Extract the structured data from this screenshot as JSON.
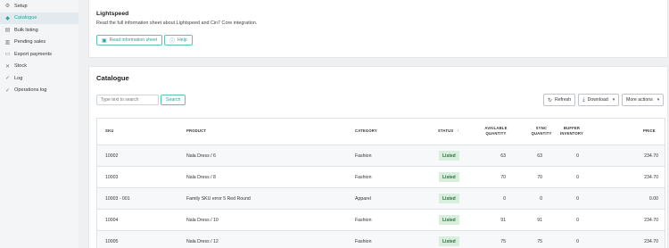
{
  "sidebar": {
    "items": [
      {
        "label": "Setup",
        "icon": "gear-icon",
        "active": false
      },
      {
        "label": "Catalogue",
        "icon": "tag-icon",
        "active": true
      },
      {
        "label": "Bulk listing",
        "icon": "list-icon",
        "active": false
      },
      {
        "label": "Pending sales",
        "icon": "receipt-icon",
        "active": false
      },
      {
        "label": "Export payments",
        "icon": "payment-icon",
        "active": false
      },
      {
        "label": "Stock",
        "icon": "tools-icon",
        "active": false
      },
      {
        "label": "Log",
        "icon": "check-icon",
        "active": false
      },
      {
        "label": "Operations log",
        "icon": "check-icon",
        "active": false
      }
    ]
  },
  "lightspeed": {
    "title": "Lightspeed",
    "description": "Read the full information sheet about Lightspeed and Cin7 Core integration.",
    "info_button": "Read information sheet",
    "help_button": "Help"
  },
  "catalogue": {
    "title": "Catalogue",
    "search_placeholder": "Type text to search",
    "search_button": "Search",
    "refresh_button": "Refresh",
    "download_button": "Download",
    "more_button": "More actions",
    "columns": {
      "sku": "SKU",
      "product": "PRODUCT",
      "category": "CATEGORY",
      "status": "STATUS",
      "available_1": "AVAILABLE",
      "available_2": "QUANTITY",
      "sync_1": "SYNC",
      "sync_2": "QUANTITY",
      "buffer_1": "BUFFER",
      "buffer_2": "INVENTORY",
      "price": "PRICE"
    },
    "rows": [
      {
        "sku": "10002",
        "product": "Nala Dress / 6",
        "category": "Fashion",
        "status": "Listed",
        "available": "63",
        "sync": "63",
        "buffer": "0",
        "price": "234.70"
      },
      {
        "sku": "10003",
        "product": "Nala Dress / 8",
        "category": "Fashion",
        "status": "Listed",
        "available": "70",
        "sync": "70",
        "buffer": "0",
        "price": "234.70"
      },
      {
        "sku": "10003 - 001",
        "product": "Family SKU error 5 Red Round",
        "category": "Apparel",
        "status": "Listed",
        "available": "0",
        "sync": "0",
        "buffer": "0",
        "price": "0.00"
      },
      {
        "sku": "10004",
        "product": "Nala Dress / 10",
        "category": "Fashion",
        "status": "Listed",
        "available": "91",
        "sync": "91",
        "buffer": "0",
        "price": "234.70"
      },
      {
        "sku": "10005",
        "product": "Nala Dress / 12",
        "category": "Fashion",
        "status": "Listed",
        "available": "75",
        "sync": "75",
        "buffer": "0",
        "price": "234.70"
      }
    ]
  },
  "colors": {
    "accent": "#2aa39a",
    "listed_badge": "#d8efdd"
  }
}
